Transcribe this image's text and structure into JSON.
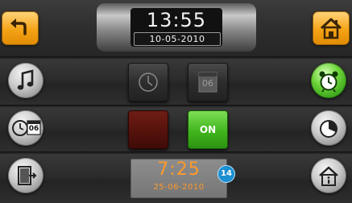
{
  "header": {
    "time": "13:55",
    "date": "10-05-2010",
    "back_icon": "back-arrow-icon",
    "home_icon": "home-icon"
  },
  "left_menu": [
    {
      "icon": "music-note-icon"
    },
    {
      "icon": "clock-calendar-icon",
      "label": "06"
    },
    {
      "icon": "door-exit-icon"
    }
  ],
  "right_menu": [
    {
      "icon": "alarm-clock-icon",
      "active": true
    },
    {
      "icon": "pie-chart-icon"
    },
    {
      "icon": "home-info-icon"
    }
  ],
  "controls": {
    "clock_icon": "clock-icon",
    "day_label": "06",
    "off_label": "",
    "on_label": "ON"
  },
  "alarm": {
    "time": "7:25",
    "date": "25-06-2010",
    "badge": "14"
  },
  "colors": {
    "orange_accent": "#f5a316",
    "green_active": "#40b51c",
    "red_inactive": "#55120c",
    "alarm_text": "#ff9a2a",
    "badge_blue": "#1c8fd0"
  }
}
